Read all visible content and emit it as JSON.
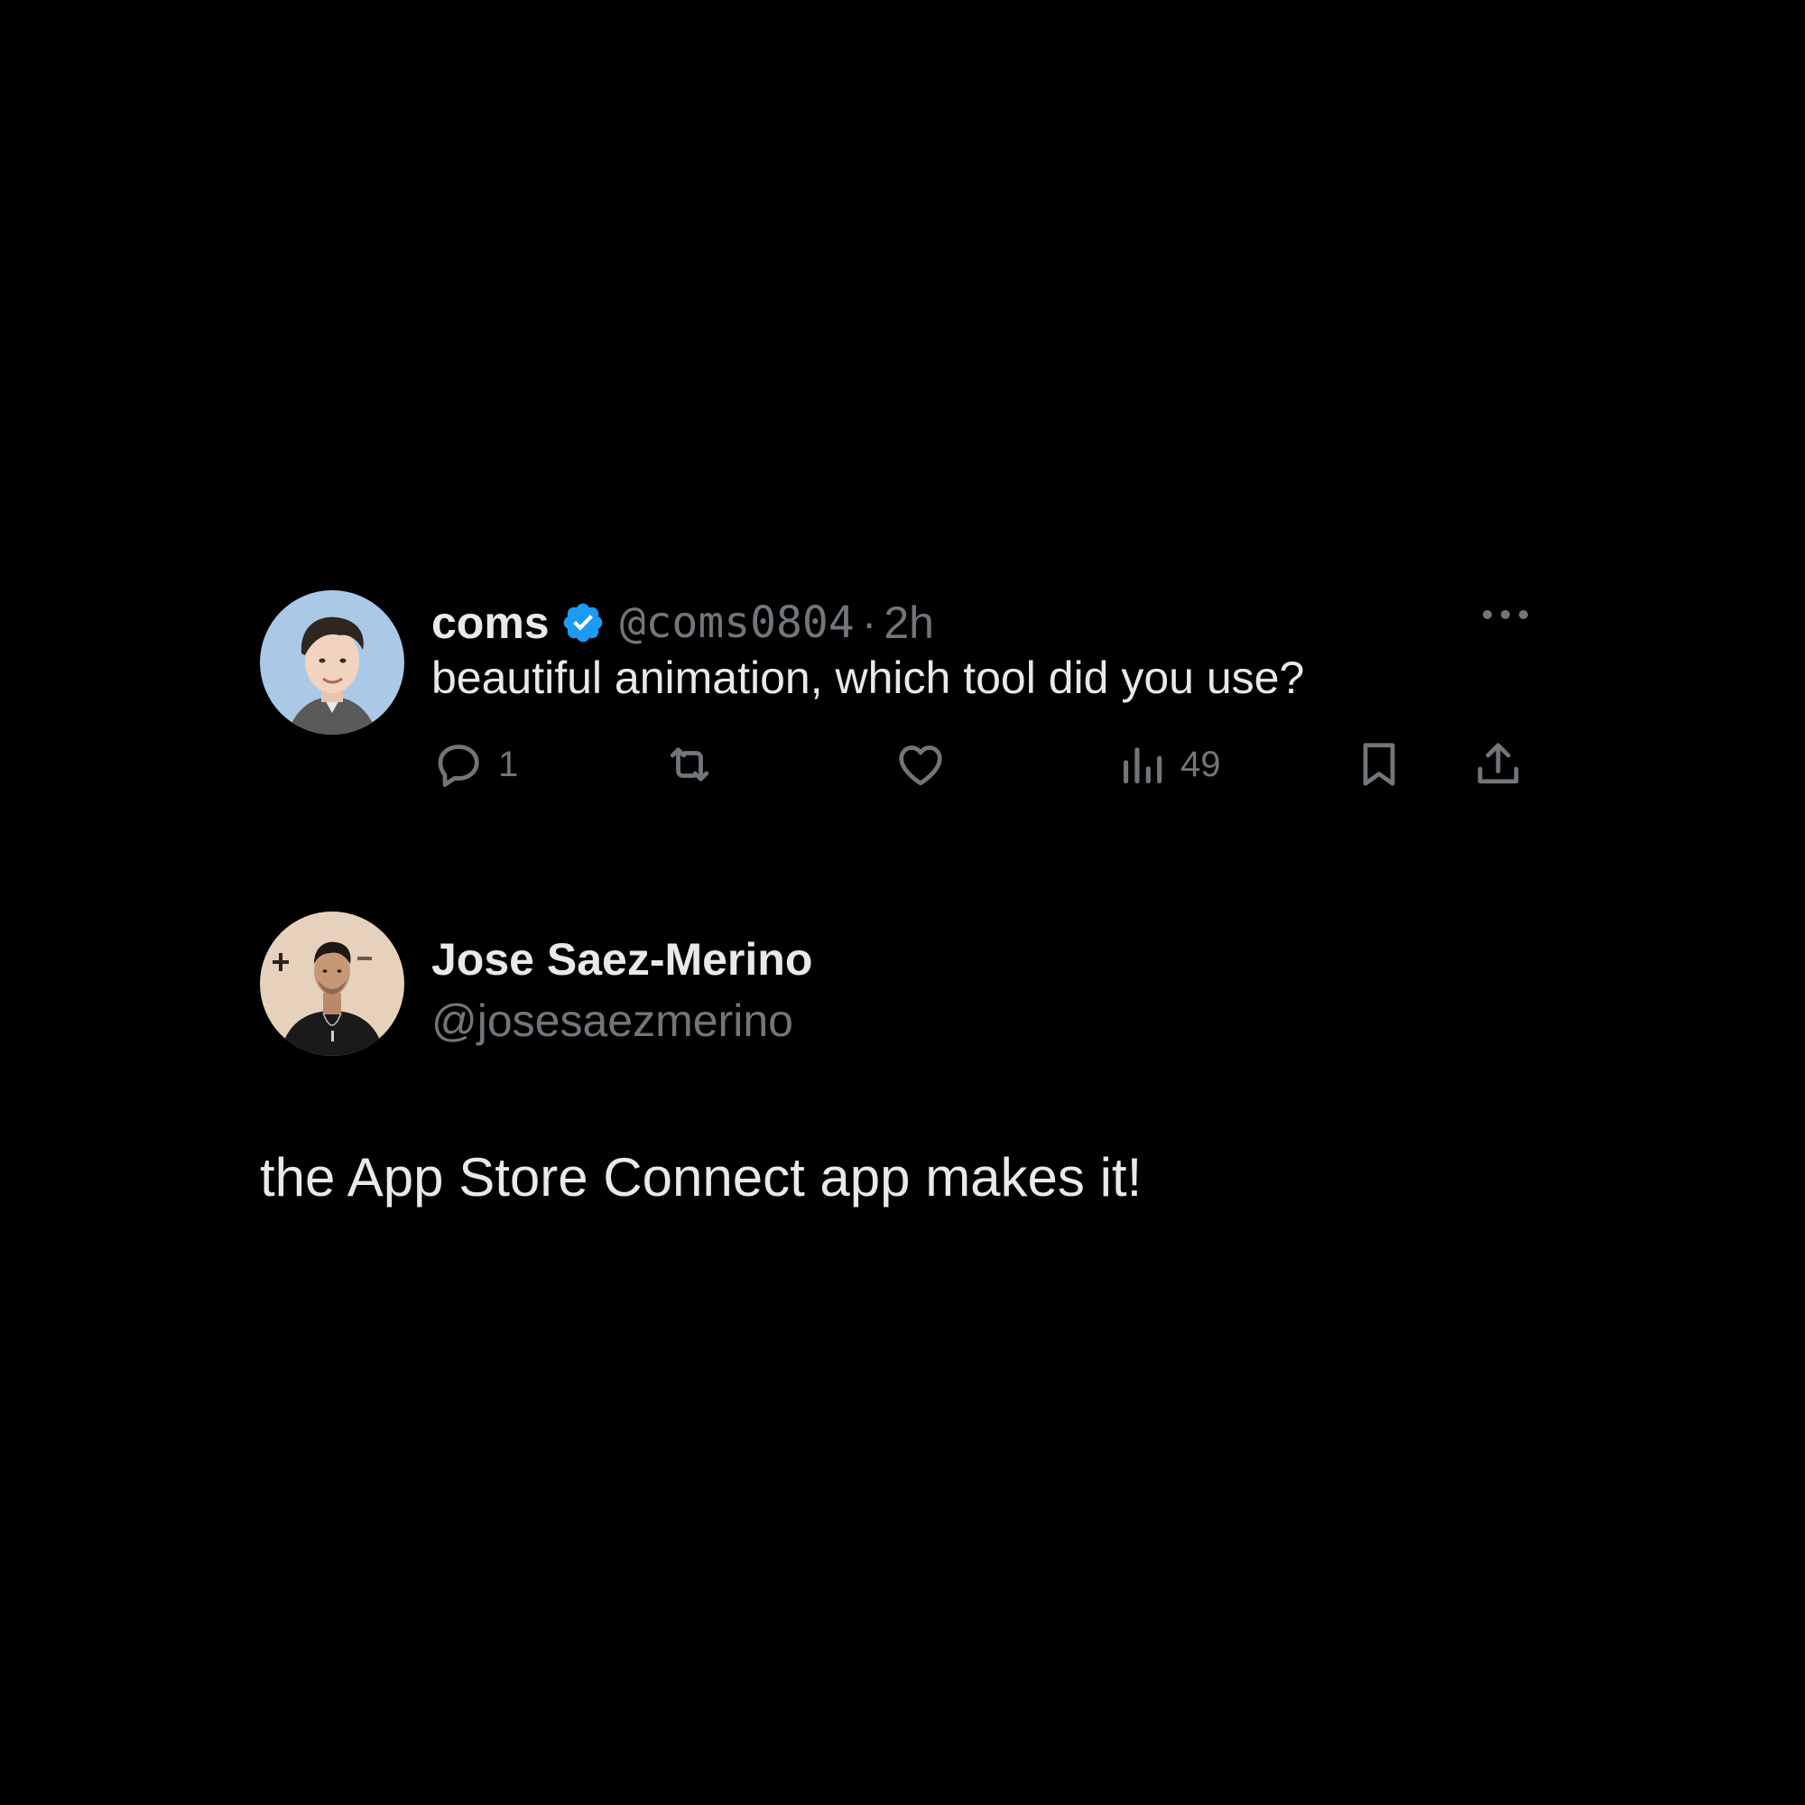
{
  "colors": {
    "background": "#000000",
    "primary_text": "#e7e9ea",
    "secondary_text": "#71767b",
    "verified_badge": "#1d9bf0"
  },
  "tweet": {
    "author": {
      "display_name": "coms",
      "handle": "@coms0804",
      "verified": true,
      "avatar_icon": "profile-photo"
    },
    "separator": "·",
    "time": "2h",
    "text": "beautiful animation, which tool did you use?",
    "actions": {
      "reply_count": "1",
      "retweet_count": "",
      "like_count": "",
      "views_count": "49"
    },
    "icons": {
      "reply": "reply-icon",
      "retweet": "retweet-icon",
      "like": "heart-icon",
      "views": "views-icon",
      "bookmark": "bookmark-icon",
      "share": "share-icon",
      "more": "more-icon"
    }
  },
  "reply": {
    "author": {
      "display_name": "Jose Saez-Merino",
      "handle": "@josesaezmerino",
      "avatar_icon": "profile-photo"
    },
    "text": "the App Store Connect app makes it!"
  }
}
